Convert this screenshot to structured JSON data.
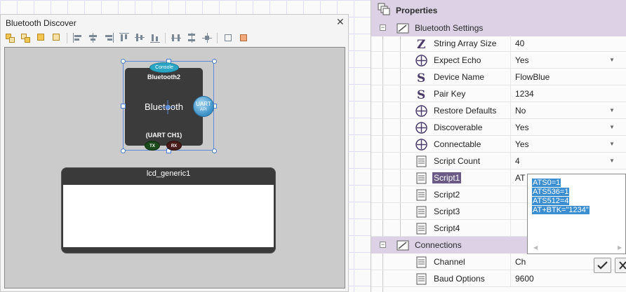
{
  "left_panel": {
    "title": "Bluetooth Discover",
    "toolbar_icons": [
      "select-items-icon",
      "group-icon",
      "bring-front-icon",
      "send-back-icon",
      "align-left-icon",
      "align-center-icon",
      "align-right-icon",
      "align-top-icon",
      "align-middle-icon",
      "align-bottom-icon",
      "distribute-horizontal-icon",
      "distribute-vertical-icon",
      "distribute-center-icon",
      "fit-size-icon",
      "resize-icon"
    ]
  },
  "components": {
    "bluetooth": {
      "console_label": "Console",
      "name": "Bluetooth2",
      "label": "Bluetooth",
      "uart_label": "UART",
      "uart_sub": "API",
      "sub_label": "(UART CH1)",
      "tx_label": "TX",
      "rx_label": "RX"
    },
    "lcd": {
      "name": "lcd_generic1"
    }
  },
  "properties": {
    "title": "Properties",
    "categories": [
      {
        "label": "Bluetooth Settings",
        "expanded": true
      },
      {
        "label": "Connections",
        "expanded": true
      }
    ],
    "bluetooth_rows": [
      {
        "icon": "string-array-icon",
        "name": "String Array Size",
        "value": "40",
        "dropdown": false
      },
      {
        "icon": "boolean-icon",
        "name": "Expect Echo",
        "value": "Yes",
        "dropdown": true
      },
      {
        "icon": "string-icon",
        "name": "Device Name",
        "value": "FlowBlue",
        "dropdown": false
      },
      {
        "icon": "string-icon",
        "name": "Pair Key",
        "value": "1234",
        "dropdown": false
      },
      {
        "icon": "boolean-icon",
        "name": "Restore Defaults",
        "value": "No",
        "dropdown": true
      },
      {
        "icon": "boolean-icon",
        "name": "Discoverable",
        "value": "Yes",
        "dropdown": true
      },
      {
        "icon": "boolean-icon",
        "name": "Connectable",
        "value": "Yes",
        "dropdown": true
      },
      {
        "icon": "list-icon",
        "name": "Script Count",
        "value": "4",
        "dropdown": true
      },
      {
        "icon": "list-icon",
        "name": "Script1",
        "value": "AT",
        "dropdown": false
      },
      {
        "icon": "list-icon",
        "name": "Script2",
        "value": "",
        "dropdown": false
      },
      {
        "icon": "list-icon",
        "name": "Script3",
        "value": "",
        "dropdown": false
      },
      {
        "icon": "list-icon",
        "name": "Script4",
        "value": "",
        "dropdown": false
      }
    ],
    "connection_rows": [
      {
        "icon": "list-icon",
        "name": "Channel",
        "value": "Ch",
        "dropdown": false
      },
      {
        "icon": "list-icon",
        "name": "Baud Options",
        "value": "9600",
        "dropdown": false
      }
    ]
  },
  "script_editor": {
    "lines": [
      "ATS0=1",
      "ATS536=1",
      "ATS512=4",
      "AT+BTK=\"1234\""
    ],
    "ok_icon": "check-icon",
    "cancel_icon": "cross-icon"
  },
  "colors": {
    "selection": "#3b8fd1",
    "category_bg": "#ddd1e6",
    "selected_row": "#6b5a86",
    "console_badge": "#2aa5c4"
  }
}
